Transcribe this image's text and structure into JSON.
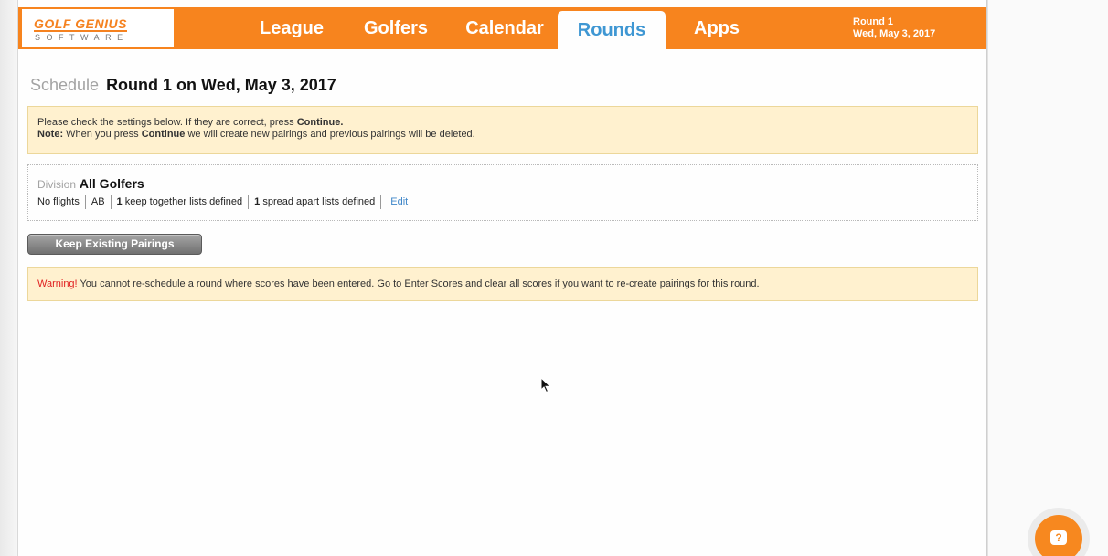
{
  "header": {
    "logo": {
      "title": "GOLF GENIUS",
      "subtitle": "SOFTWARE"
    },
    "nav": [
      {
        "label": "League"
      },
      {
        "label": "Golfers"
      },
      {
        "label": "Calendar"
      },
      {
        "label": "Rounds",
        "active": true
      },
      {
        "label": "Apps"
      }
    ],
    "round_label": "Round 1",
    "round_date": "Wed, May 3, 2017"
  },
  "page": {
    "section": "Schedule",
    "title": "Round 1 on Wed, May 3, 2017"
  },
  "notice": {
    "line1_prefix": "Please check the settings below. If they are correct, press",
    "line1_action": "Continue.",
    "note_label": "Note:",
    "line2_part1": "When you press",
    "line2_action": "Continue",
    "line2_part2": "we will create new pairings and previous pairings will be deleted."
  },
  "division": {
    "label": "Division",
    "name": "All Golfers",
    "flights": "No flights",
    "code": "AB",
    "keep_together_count": "1",
    "keep_together_text": "keep together lists defined",
    "spread_apart_count": "1",
    "spread_apart_text": "spread apart lists defined",
    "edit_label": "Edit"
  },
  "keep_button": {
    "label": "Keep Existing Pairings"
  },
  "warning": {
    "label": "Warning!",
    "text": "You cannot re-schedule a round where scores have been entered. Go to Enter Scores and clear all scores if you want to re-create pairings for this round."
  },
  "help": {
    "icon": "help-chat-icon",
    "glyph": "?"
  },
  "colors": {
    "brand_orange": "#f7841e",
    "active_tab": "#3f97d3",
    "notice_bg": "#fff1cf",
    "warning_red": "#e02020",
    "link": "#3f86c8"
  }
}
